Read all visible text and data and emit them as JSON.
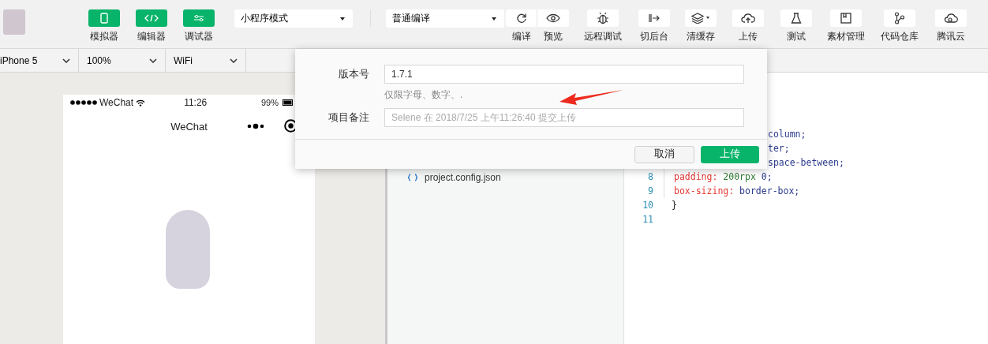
{
  "view_buttons": [
    {
      "label": "模拟器"
    },
    {
      "label": "编辑器"
    },
    {
      "label": "调试器"
    }
  ],
  "mode_select": {
    "value": "小程序模式"
  },
  "compile_select": {
    "value": "普通编译"
  },
  "actions": [
    {
      "label": "编译"
    },
    {
      "label": "预览"
    },
    {
      "label": "远程调试"
    },
    {
      "label": "切后台"
    },
    {
      "label": "清缓存"
    },
    {
      "label": "上传"
    },
    {
      "label": "测试"
    },
    {
      "label": "素材管理"
    },
    {
      "label": "代码仓库"
    },
    {
      "label": "腾讯云"
    }
  ],
  "device_bar": [
    {
      "value": "iPhone 5"
    },
    {
      "value": "100%"
    },
    {
      "value": "WiFi"
    }
  ],
  "simulator": {
    "carrier": "WeChat",
    "time": "11:26",
    "battery": "99%",
    "nav_title": "WeChat"
  },
  "file_tree": [
    {
      "name": "project.config.json"
    }
  ],
  "code_lines": [
    {
      "kind": "partial",
      "tokens": [
        {
          "text": "column;",
          "kind": "value"
        }
      ]
    },
    {
      "kind": "partial",
      "tokens": [
        {
          "text": "ter;",
          "kind": "value"
        }
      ]
    },
    {
      "kind": "partial",
      "tokens": [
        {
          "text": "space-between;",
          "kind": "value"
        }
      ]
    },
    {
      "number": "8",
      "kind": "indented",
      "tokens": [
        {
          "text": "padding:",
          "kind": "property"
        },
        {
          "text": " 200rpx",
          "kind": "number"
        },
        {
          "text": " 0;",
          "kind": "value"
        }
      ]
    },
    {
      "number": "9",
      "kind": "indented",
      "tokens": [
        {
          "text": "box-sizing:",
          "kind": "property"
        },
        {
          "text": " border-box;",
          "kind": "value"
        }
      ]
    },
    {
      "number": "10",
      "kind": "plain",
      "tokens": [
        {
          "text": "}",
          "kind": "punct"
        }
      ]
    },
    {
      "number": "11",
      "kind": "plain"
    }
  ],
  "dialog": {
    "fields": [
      {
        "label": "版本号",
        "value": "1.7.1",
        "hint": "仅限字母、数字、."
      },
      {
        "label": "项目备注",
        "placeholder": "Selene 在 2018/7/25 上午11:26:40 提交上传"
      }
    ],
    "buttons": [
      {
        "label": "取消",
        "kind": "secondary"
      },
      {
        "label": "上传",
        "kind": "primary"
      }
    ]
  }
}
